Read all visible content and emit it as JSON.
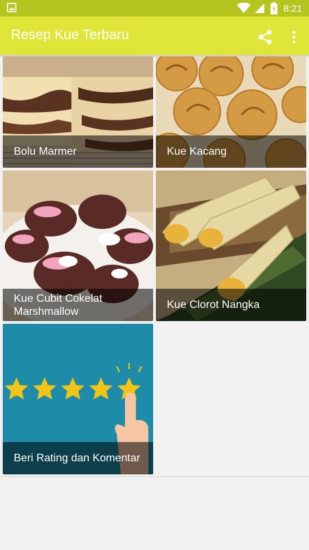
{
  "status": {
    "time": "8:21"
  },
  "app": {
    "title": "Resep Kue Terbaru"
  },
  "cards": [
    {
      "label": "Bolu Marmer"
    },
    {
      "label": "Kue Kacang"
    },
    {
      "label": "Kue Cubit Cokelat Marshmallow"
    },
    {
      "label": "Kue Clorot Nangka"
    },
    {
      "label": "Beri Rating dan Komentar"
    }
  ],
  "colors": {
    "statusbar": "#b5c41f",
    "appbar": "#dfe637",
    "rating_bg": "#1e8ba8",
    "star": "#f2c418"
  },
  "icons": [
    "image-icon",
    "wifi-icon",
    "signal-icon",
    "battery-icon",
    "share-icon",
    "more-vert-icon"
  ]
}
